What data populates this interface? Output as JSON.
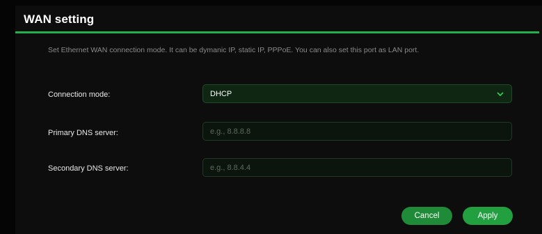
{
  "section": {
    "title": "WAN setting",
    "description": "Set Ethernet WAN connection mode. It can be dymanic IP, static IP, PPPoE. You can also set this port as LAN port."
  },
  "form": {
    "connection_mode": {
      "label": "Connection mode:",
      "value": "DHCP",
      "icon": "chevron-down-icon"
    },
    "primary_dns": {
      "label": "Primary DNS server:",
      "value": "",
      "placeholder": "e.g., 8.8.8.8"
    },
    "secondary_dns": {
      "label": "Secondary DNS server:",
      "value": "",
      "placeholder": "e.g., 8.8.4.4"
    }
  },
  "actions": {
    "cancel_label": "Cancel",
    "apply_label": "Apply"
  },
  "colors": {
    "accent": "#22b14c",
    "button": "#22a040",
    "background": "#0d0d0d"
  }
}
